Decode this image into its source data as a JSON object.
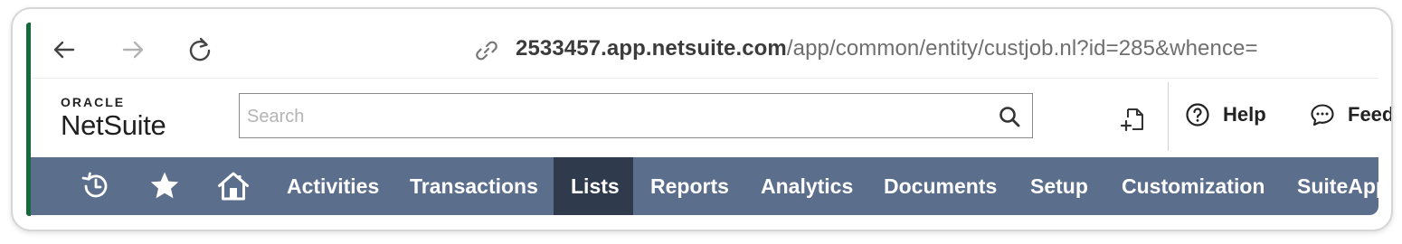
{
  "browser": {
    "url_host": "2533457.app.netsuite.com",
    "url_path": "/app/common/entity/custjob.nl?id=285&whence=",
    "icons": [
      "back-arrow-icon",
      "forward-arrow-icon",
      "reload-icon",
      "link-icon"
    ]
  },
  "header": {
    "logo_oracle": "ORACLE",
    "logo_netsuite": "NetSuite",
    "search_placeholder": "Search",
    "help_label": "Help",
    "feedback_label": "Feedback"
  },
  "menu": {
    "items": [
      {
        "label": "Activities",
        "active": false
      },
      {
        "label": "Transactions",
        "active": false
      },
      {
        "label": "Lists",
        "active": true
      },
      {
        "label": "Reports",
        "active": false
      },
      {
        "label": "Analytics",
        "active": false
      },
      {
        "label": "Documents",
        "active": false
      },
      {
        "label": "Setup",
        "active": false
      },
      {
        "label": "Customization",
        "active": false
      },
      {
        "label": "SuiteApps",
        "active": false
      }
    ]
  },
  "colors": {
    "menubar": "#5b6e8c",
    "menu_active": "#2f3a4d",
    "accent": "#156a3b"
  }
}
